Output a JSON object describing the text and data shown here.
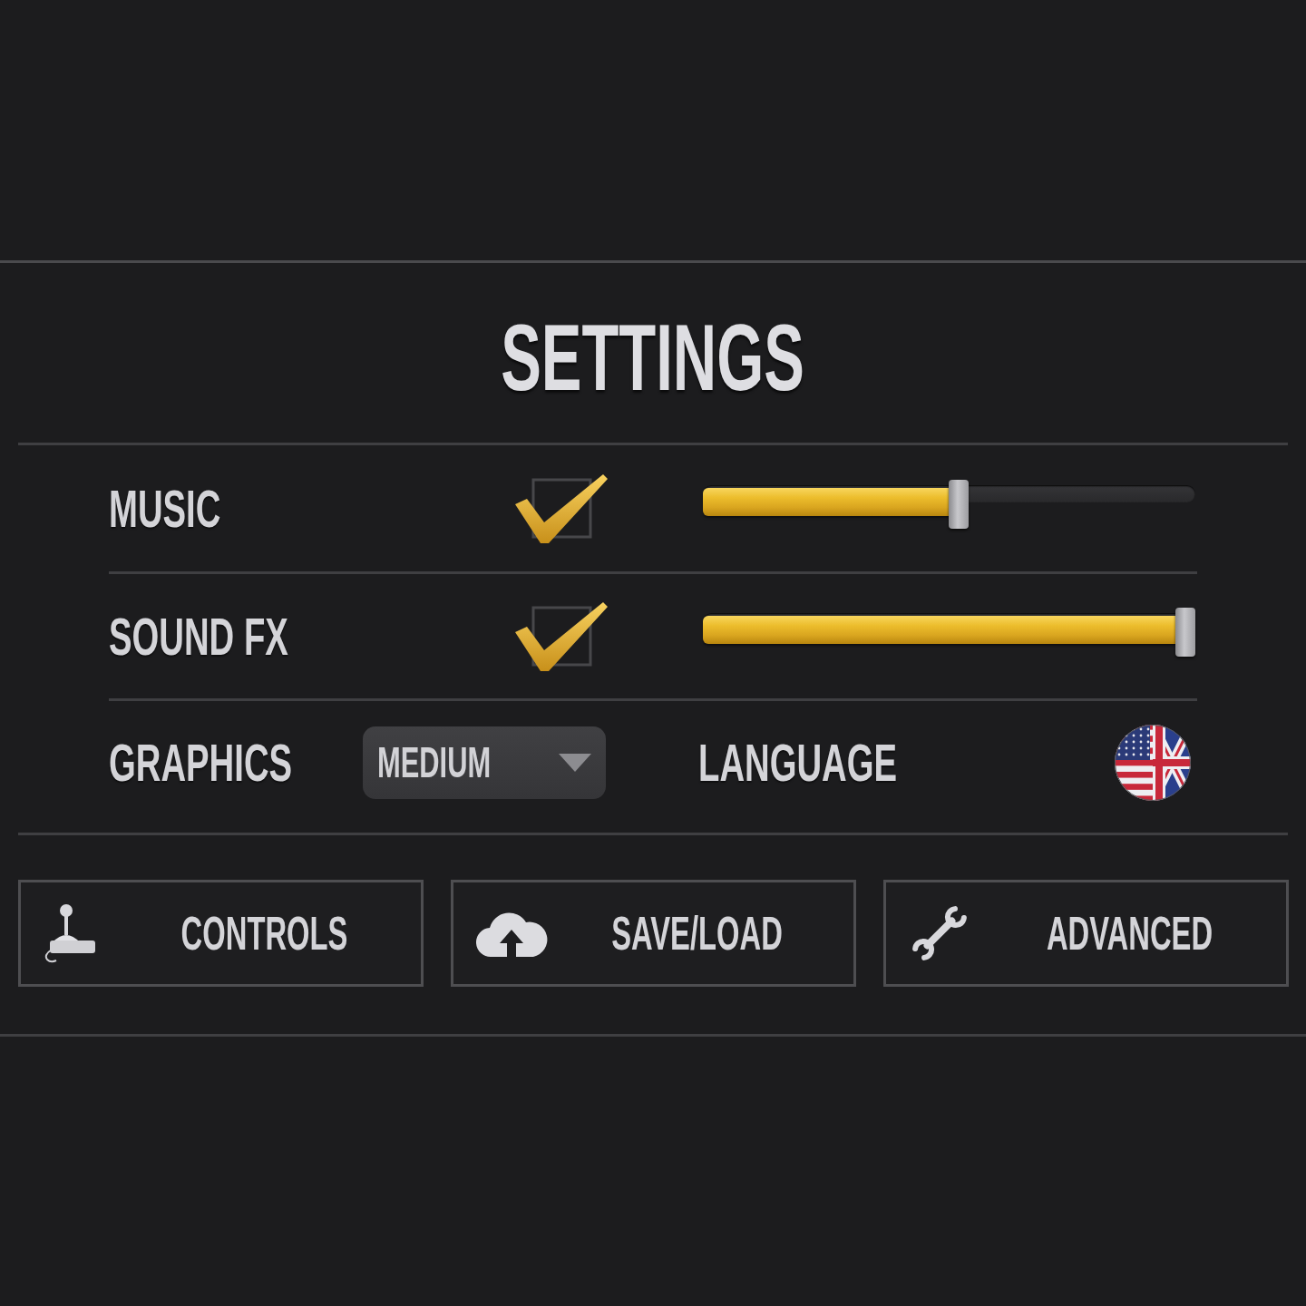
{
  "title": "SETTINGS",
  "settings": [
    {
      "label": "MUSIC",
      "checked": true,
      "level": 0.52
    },
    {
      "label": "SOUND FX",
      "checked": true,
      "level": 1
    }
  ],
  "graphics": {
    "label": "GRAPHICS",
    "value": "MEDIUM"
  },
  "language": {
    "label": "LANGUAGE"
  },
  "buttons": [
    {
      "label": "CONTROLS"
    },
    {
      "label": "SAVE/LOAD"
    },
    {
      "label": "ADVANCED"
    }
  ]
}
